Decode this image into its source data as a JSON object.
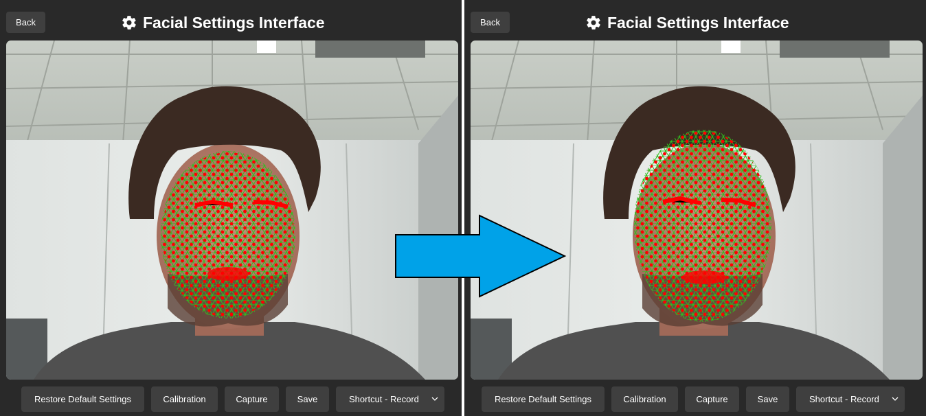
{
  "panels": [
    {
      "back_label": "Back",
      "title": "Facial Settings Interface",
      "title_icon": "gear-icon",
      "toolbar": {
        "restore_label": "Restore Default Settings",
        "calibration_label": "Calibration",
        "capture_label": "Capture",
        "save_label": "Save",
        "shortcut_selected": "Shortcut - Record"
      }
    },
    {
      "back_label": "Back",
      "title": "Facial Settings Interface",
      "title_icon": "gear-icon",
      "toolbar": {
        "restore_label": "Restore Default Settings",
        "calibration_label": "Calibration",
        "capture_label": "Capture",
        "save_label": "Save",
        "shortcut_selected": "Shortcut - Record"
      }
    }
  ],
  "colors": {
    "panel_bg": "#292929",
    "button_bg": "#3f3f3f",
    "mesh_line": "#2fbf1f",
    "mesh_point": "#ff0000",
    "arrow_fill": "#00a2e8"
  },
  "overlay": {
    "icon": "right-arrow-icon"
  }
}
